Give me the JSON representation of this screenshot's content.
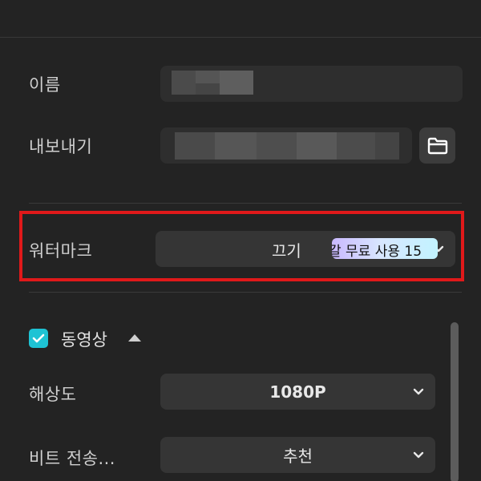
{
  "name_row": {
    "label": "이름"
  },
  "export_row": {
    "label": "내보내기",
    "folder_icon": "folder-icon"
  },
  "watermark_row": {
    "label": "워터마크",
    "value": "끄기",
    "badge_text": "갈 무료 사용 15"
  },
  "video_section": {
    "title": "동영상",
    "checked": true,
    "resolution": {
      "label": "해상도",
      "value": "1080P"
    },
    "bitrate": {
      "label": "비트 전송...",
      "value": "추천"
    }
  },
  "colors": {
    "background": "#232323",
    "accent": "#1ec3d4",
    "highlight": "#e0191a"
  }
}
